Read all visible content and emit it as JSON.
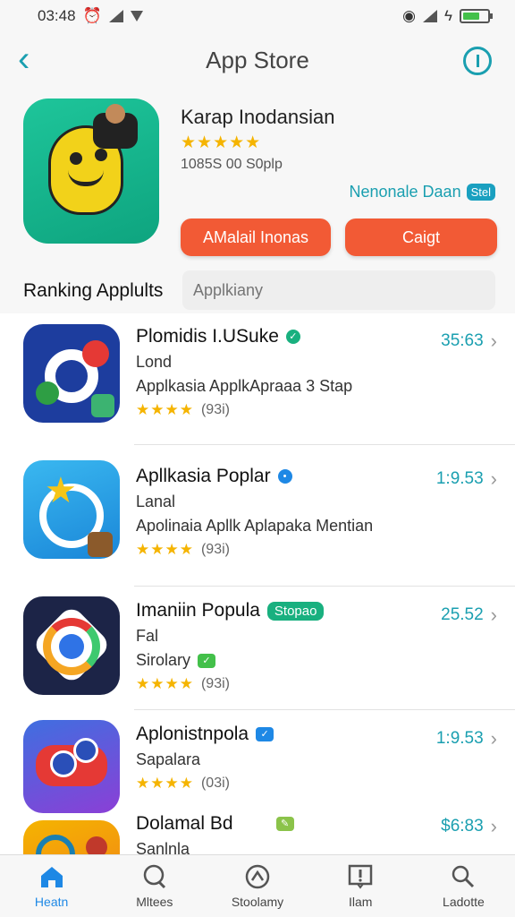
{
  "status_bar": {
    "time": "03:48"
  },
  "header": {
    "title": "App Store"
  },
  "featured": {
    "name": "Karap Inodansian",
    "stars": "★★★★★",
    "subtitle": "1085S 00 S0plp",
    "link_text": "Nenonale Daan",
    "link_badge": "Stel",
    "button_primary": "AMalail Inonas",
    "button_secondary": "Caigt"
  },
  "ranking": {
    "title": "Ranking Applults",
    "search_placeholder": "Applkiany"
  },
  "apps": [
    {
      "name": "Plomidis I.USuke",
      "subtitle": "Lond",
      "description": "Applkasia ApplkApraaa 3 Stap",
      "stars": "★★★★",
      "rating_count": "(93i)",
      "price": "35:63"
    },
    {
      "name": "Apllkasia Poplar",
      "subtitle": "Lanal",
      "description": "Apolinaia Apllk Aplapaka Mentian",
      "stars": "★★★★",
      "rating_count": "(93i)",
      "price": "1:9.53"
    },
    {
      "name": "Imaniin Popula",
      "tag": "Stopao",
      "subtitle": "Fal",
      "description": "Sirolary",
      "stars": "★★★★",
      "rating_count": "(93i)",
      "price": "25.52"
    },
    {
      "name": "Aplonistnpola",
      "subtitle": "Sapalara",
      "stars": "★★★★",
      "rating_count": "(03i)",
      "price": "1:9.53"
    },
    {
      "name": "Dolamal Bd",
      "subtitle": "Sanlnla",
      "price": "$6:83"
    }
  ],
  "tabs": [
    {
      "label": "Heatn",
      "icon": "home-icon"
    },
    {
      "label": "Mltees",
      "icon": "search-bubble-icon"
    },
    {
      "label": "Stoolamy",
      "icon": "game-controller-icon"
    },
    {
      "label": "Ilam",
      "icon": "alert-square-icon"
    },
    {
      "label": "Ladotte",
      "icon": "search-icon"
    }
  ],
  "colors": {
    "accent": "#1a9fb0",
    "button": "#f25a35",
    "star": "#f5b400",
    "tab_active": "#1e88e5"
  }
}
